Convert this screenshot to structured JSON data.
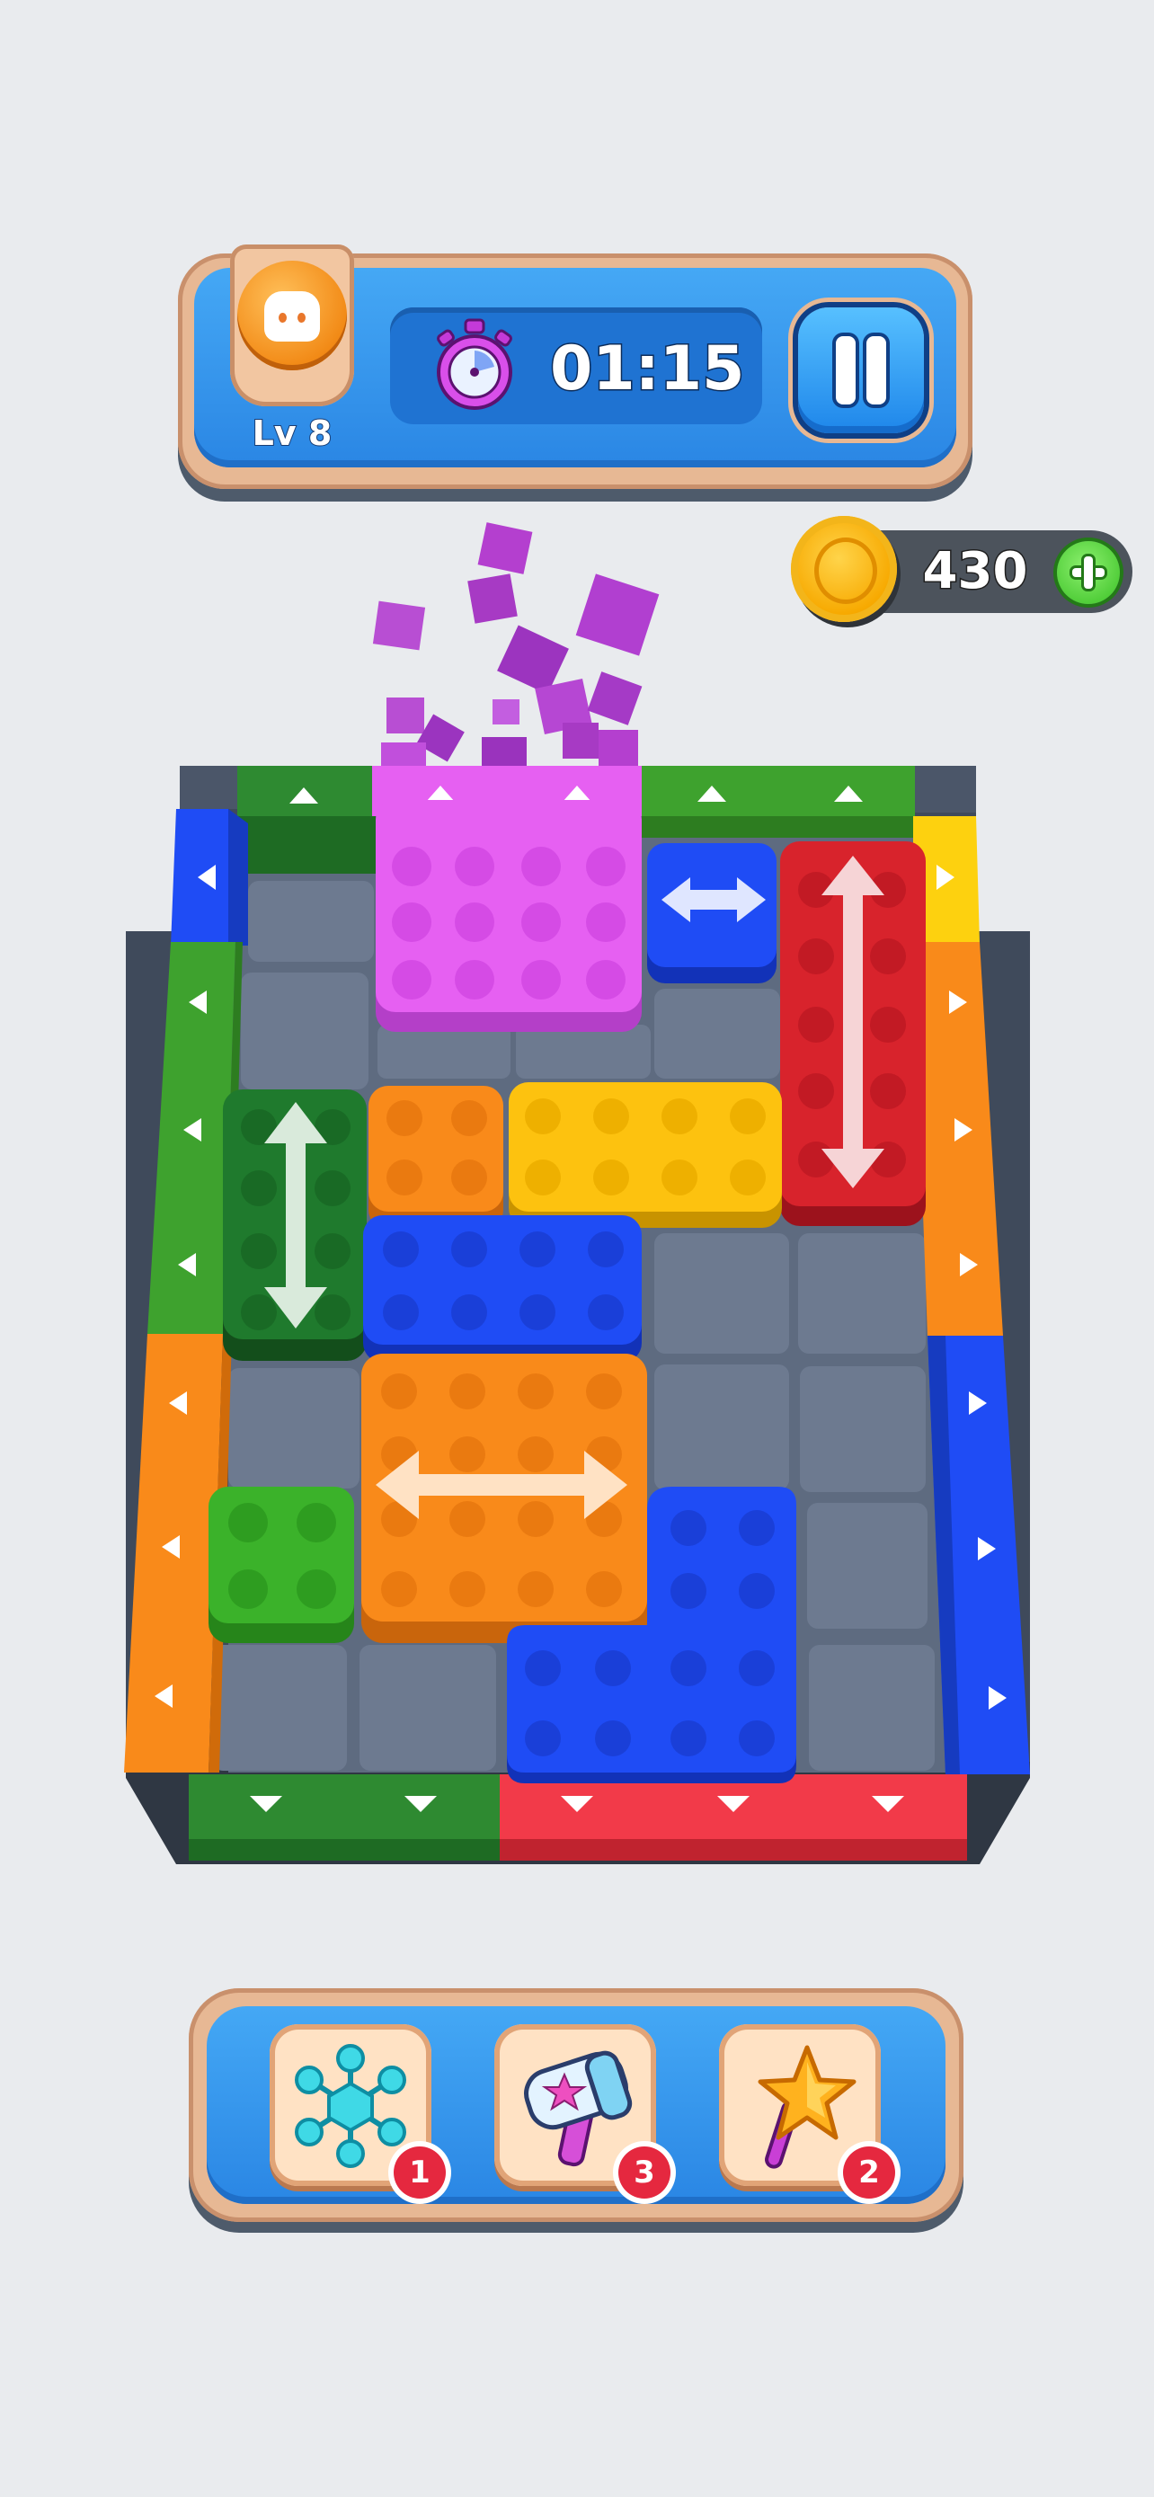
{
  "hud": {
    "level_label": "Lv 8",
    "timer": "01:15",
    "pause_icon": "pause-icon",
    "stopwatch_icon": "stopwatch-icon"
  },
  "currency": {
    "coins": "430",
    "coin_icon": "coin-icon",
    "add_icon": "plus-icon"
  },
  "board": {
    "rows": 7,
    "cols": 5,
    "blocks": [
      {
        "name": "magenta-block",
        "color": "#e14bf0",
        "movement": "none"
      },
      {
        "name": "blue-small-block",
        "color": "#1f4cf5",
        "movement": "horizontal"
      },
      {
        "name": "red-block",
        "color": "#d8232c",
        "movement": "vertical"
      },
      {
        "name": "dark-green-block",
        "color": "#1f7a2d",
        "movement": "vertical"
      },
      {
        "name": "orange-small-block",
        "color": "#f98a1a",
        "movement": "none"
      },
      {
        "name": "yellow-block",
        "color": "#fdc20f",
        "movement": "none"
      },
      {
        "name": "blue-wide-block",
        "color": "#1f4cf5",
        "movement": "none"
      },
      {
        "name": "orange-big-block",
        "color": "#f98a1a",
        "movement": "horizontal"
      },
      {
        "name": "green-block",
        "color": "#3bb22a",
        "movement": "none"
      },
      {
        "name": "blue-l-block",
        "color": "#1f4cf5",
        "movement": "none"
      }
    ],
    "exits": {
      "top": [
        "#2e8a31",
        "#e14bf0",
        "#3ea22e"
      ],
      "bottom": [
        "#2e8a31",
        "#f23a49"
      ],
      "left": [
        "#1f4cf5",
        "#3ea22e",
        "#f98a1a"
      ],
      "right": [
        "#fdd10f",
        "#f98a1a",
        "#1f4cf5"
      ]
    }
  },
  "boosters": [
    {
      "name": "freeze",
      "icon": "snowflake-icon",
      "count": "1"
    },
    {
      "name": "hammer",
      "icon": "hammer-icon",
      "count": "3"
    },
    {
      "name": "magic-wand",
      "icon": "star-wand-icon",
      "count": "2"
    }
  ],
  "colors": {
    "background": "#e9ebee",
    "hud_blue": "#2a86e4",
    "frame": "#e7b894",
    "badge_red": "#e5283f"
  }
}
